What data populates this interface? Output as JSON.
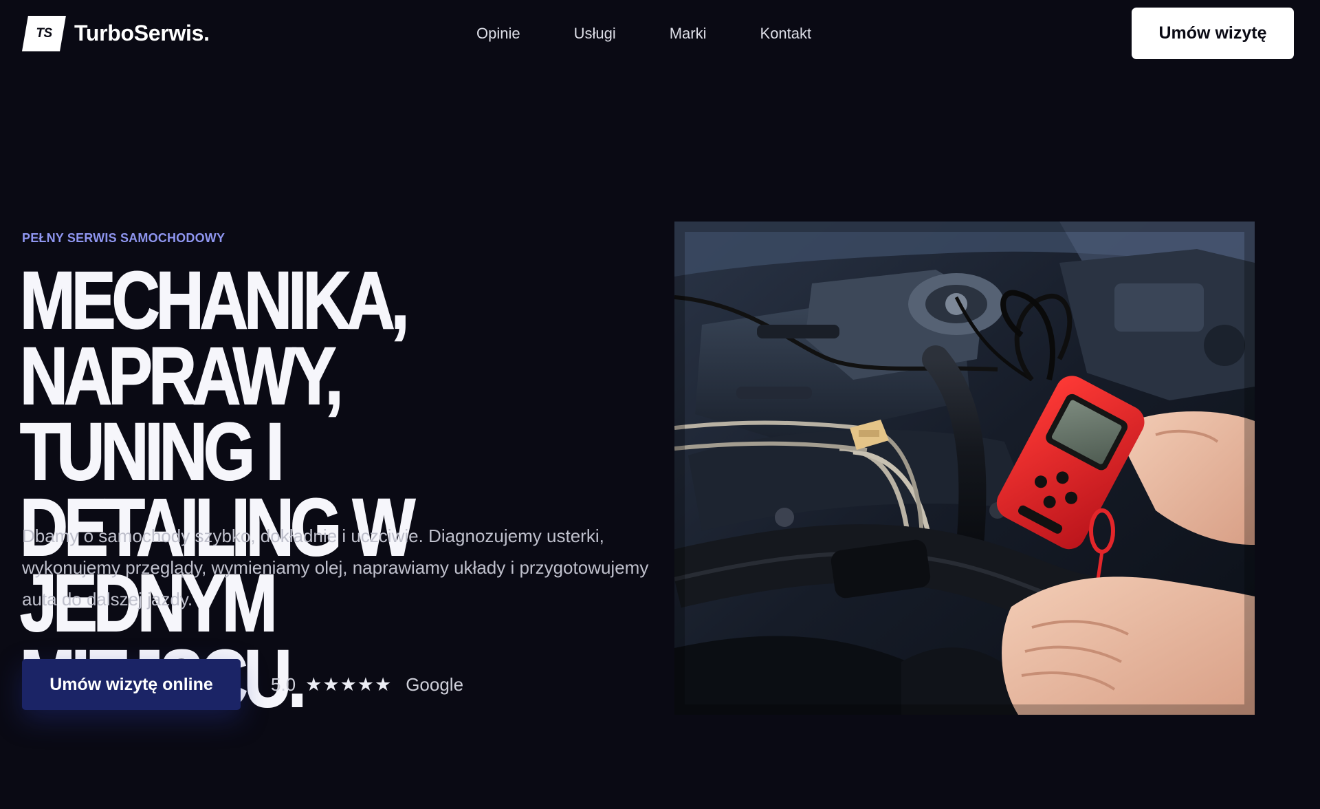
{
  "header": {
    "logo_mark": "TS",
    "brand_name": "TurboSerwis.",
    "nav": [
      {
        "label": "Opinie"
      },
      {
        "label": "Usługi"
      },
      {
        "label": "Marki"
      },
      {
        "label": "Kontakt"
      }
    ],
    "cta_label": "Umów wizytę"
  },
  "hero": {
    "eyebrow": "PEŁNY SERWIS SAMOCHODOWY",
    "headline": "MECHANIKA, NAPRAWY, TUNING I DETAILING W JEDNYM MIEJSCU.",
    "lead": "Dbamy o samochody szybko, dokładnie i uczciwie. Diagnozujemy usterki, wykonujemy przeglądy, wymieniamy olej, naprawiamy układy i przygotowujemy auta do dalszej jazdy.",
    "cta_label": "Umów wizytę online",
    "rating": {
      "score": "5.0",
      "stars": "★★★★★",
      "source": "Google",
      "value": 5,
      "max": 5
    },
    "image": {
      "icon": "engine-diagnostics-photo"
    }
  },
  "colors": {
    "background": "#0a0a14",
    "accent": "#8f96f0",
    "primary_button": "#1b2466",
    "header_button": "#ffffff",
    "scanner_red": "#e3262a"
  }
}
